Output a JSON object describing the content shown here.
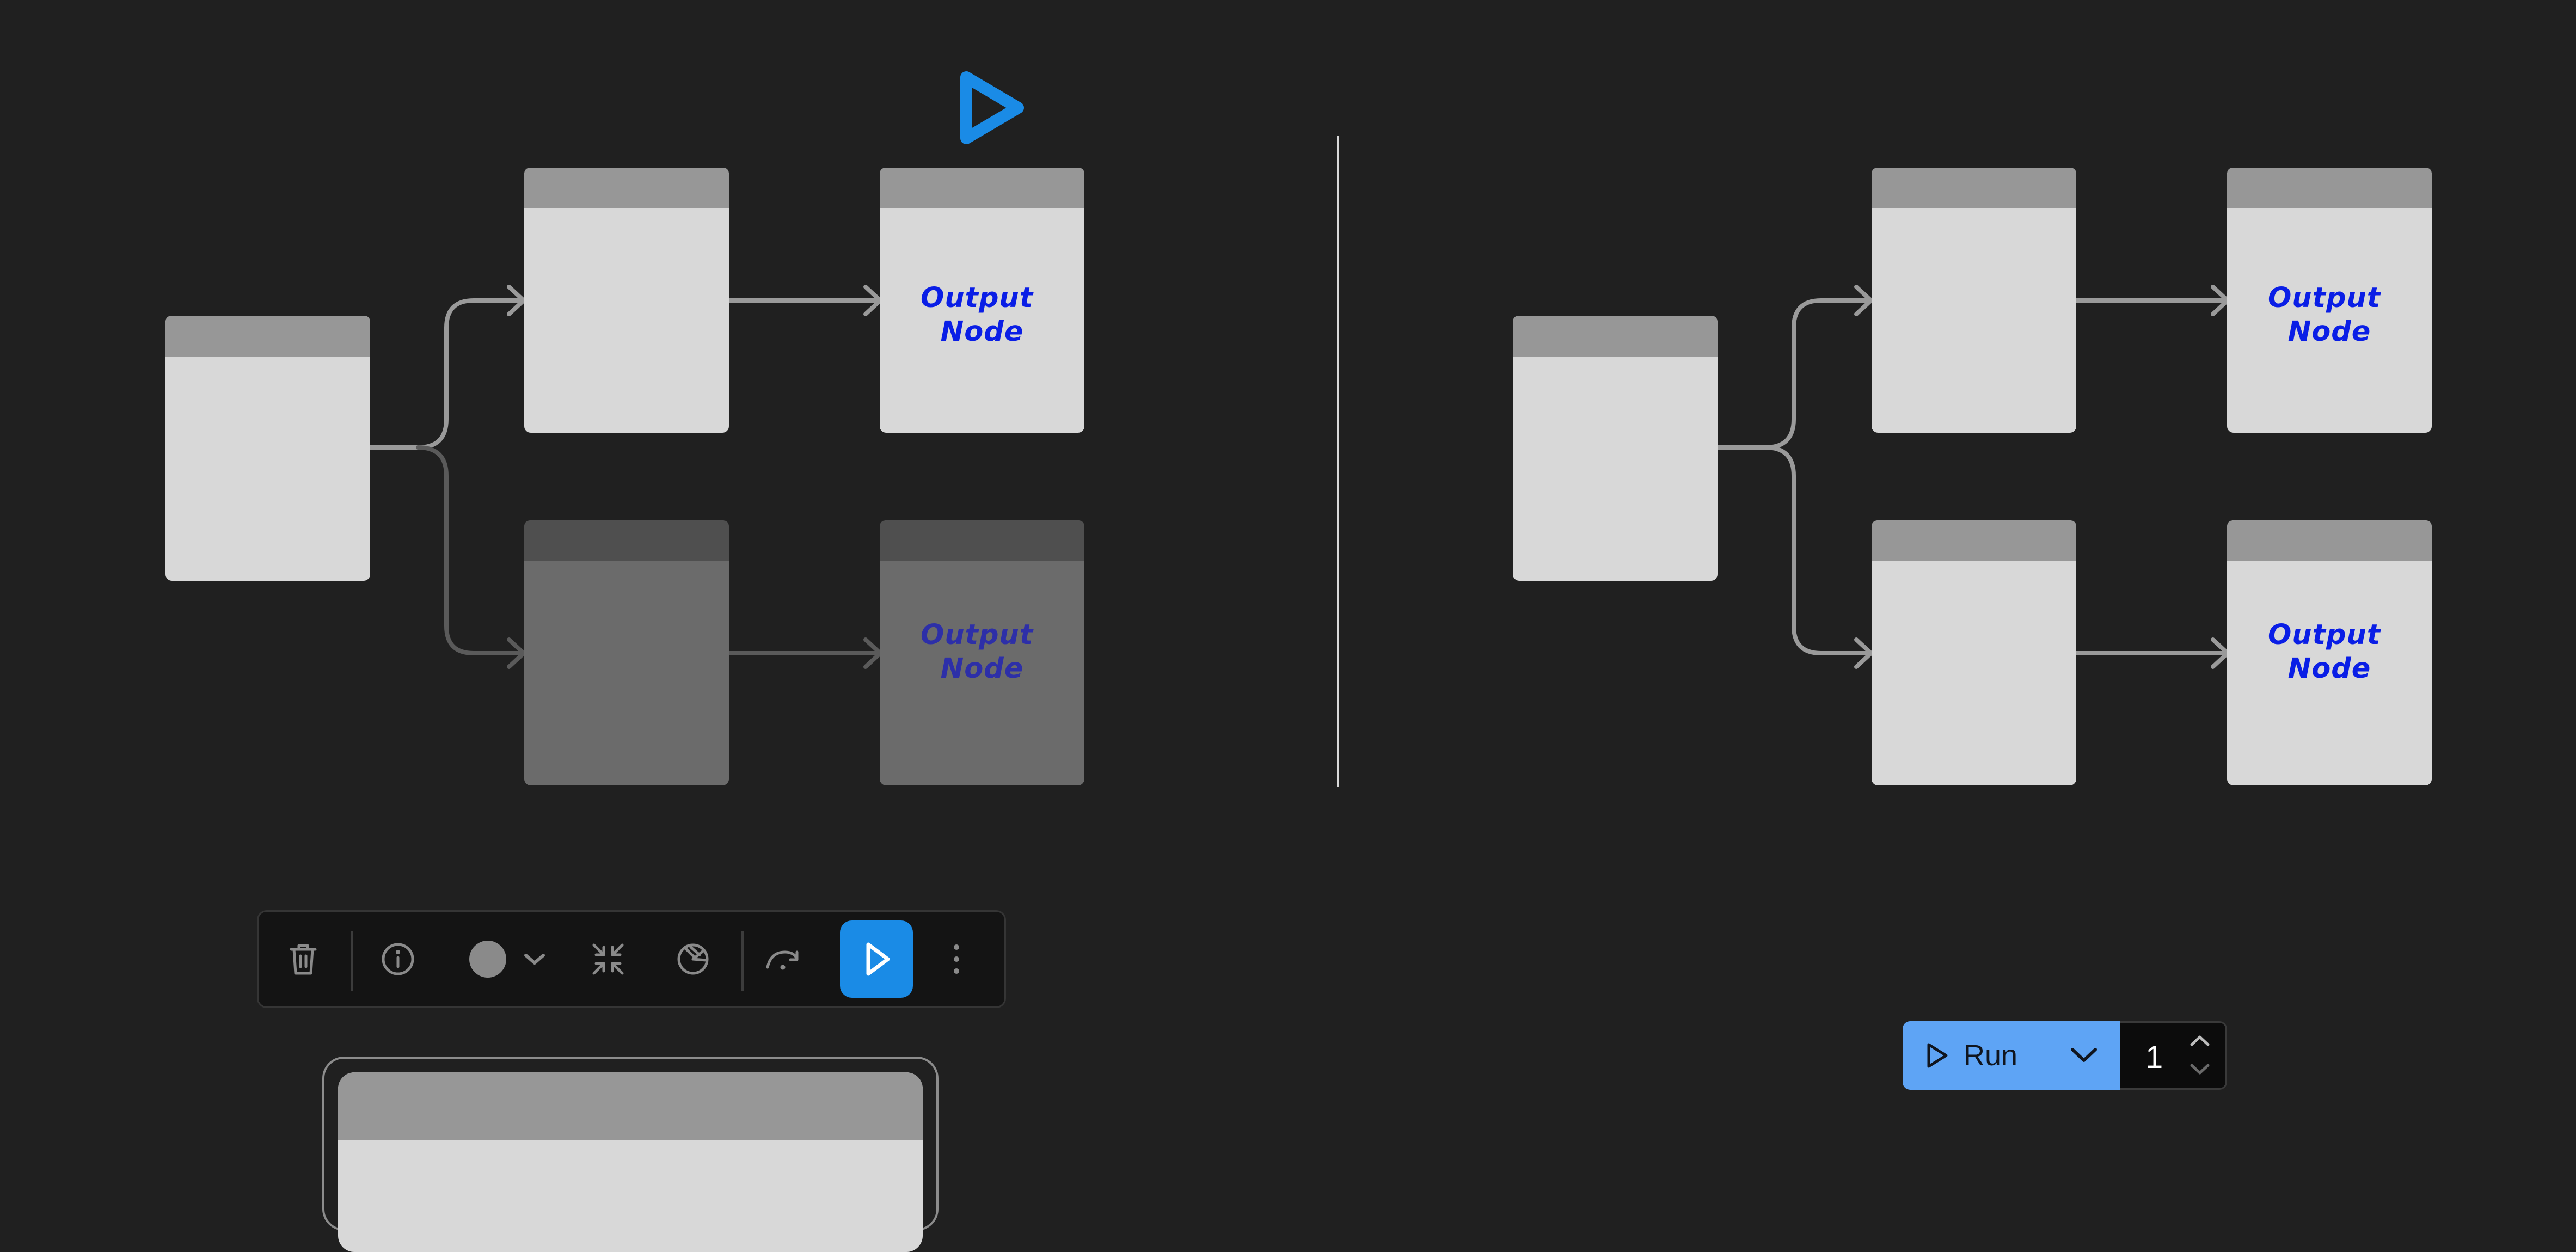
{
  "diagrams": {
    "left": {
      "node_title": "Output Node",
      "nodes": [
        {
          "role": "source",
          "state": "active"
        },
        {
          "role": "middle",
          "branch": "top",
          "state": "active"
        },
        {
          "role": "output",
          "branch": "top",
          "state": "active"
        },
        {
          "role": "middle",
          "branch": "bottom",
          "state": "inactive"
        },
        {
          "role": "output",
          "branch": "bottom",
          "state": "inactive"
        }
      ],
      "indicator_icon": "play-triangle-icon"
    },
    "right": {
      "node_title": "Output Node",
      "nodes": [
        {
          "role": "source",
          "state": "active"
        },
        {
          "role": "middle",
          "branch": "top",
          "state": "active"
        },
        {
          "role": "output",
          "branch": "top",
          "state": "active"
        },
        {
          "role": "middle",
          "branch": "bottom",
          "state": "active"
        },
        {
          "role": "output",
          "branch": "bottom",
          "state": "active"
        }
      ]
    }
  },
  "toolbar": {
    "buttons": [
      {
        "name": "delete",
        "icon": "trash-icon"
      },
      {
        "name": "info",
        "icon": "info-icon"
      },
      {
        "name": "color",
        "icon": "color-dot-icon"
      },
      {
        "name": "color-menu",
        "icon": "chevron-down-icon"
      },
      {
        "name": "collapse",
        "icon": "collapse-icon"
      },
      {
        "name": "bypass",
        "icon": "bypass-icon"
      },
      {
        "name": "redo",
        "icon": "redo-arrow-icon"
      },
      {
        "name": "execute",
        "icon": "play-icon"
      },
      {
        "name": "more",
        "icon": "more-vertical-icon"
      }
    ]
  },
  "run_control": {
    "label": "Run",
    "count": "1",
    "icons": [
      "play-icon",
      "chevron-down-icon",
      "chevron-up-icon",
      "chevron-down-icon"
    ]
  },
  "colors": {
    "background": "#202020",
    "node_body": "#d8d8d8",
    "node_header": "#979797",
    "inactive_body": "#6b6b6b",
    "inactive_header": "#4f4f4f",
    "output_text": "#0a1ee6",
    "output_text_inactive": "#2d2fa8",
    "accent": "#1a8be6",
    "run_button": "#5ea4f5",
    "edge": "#9a9a9a",
    "edge_inactive": "#5a5a5a"
  }
}
